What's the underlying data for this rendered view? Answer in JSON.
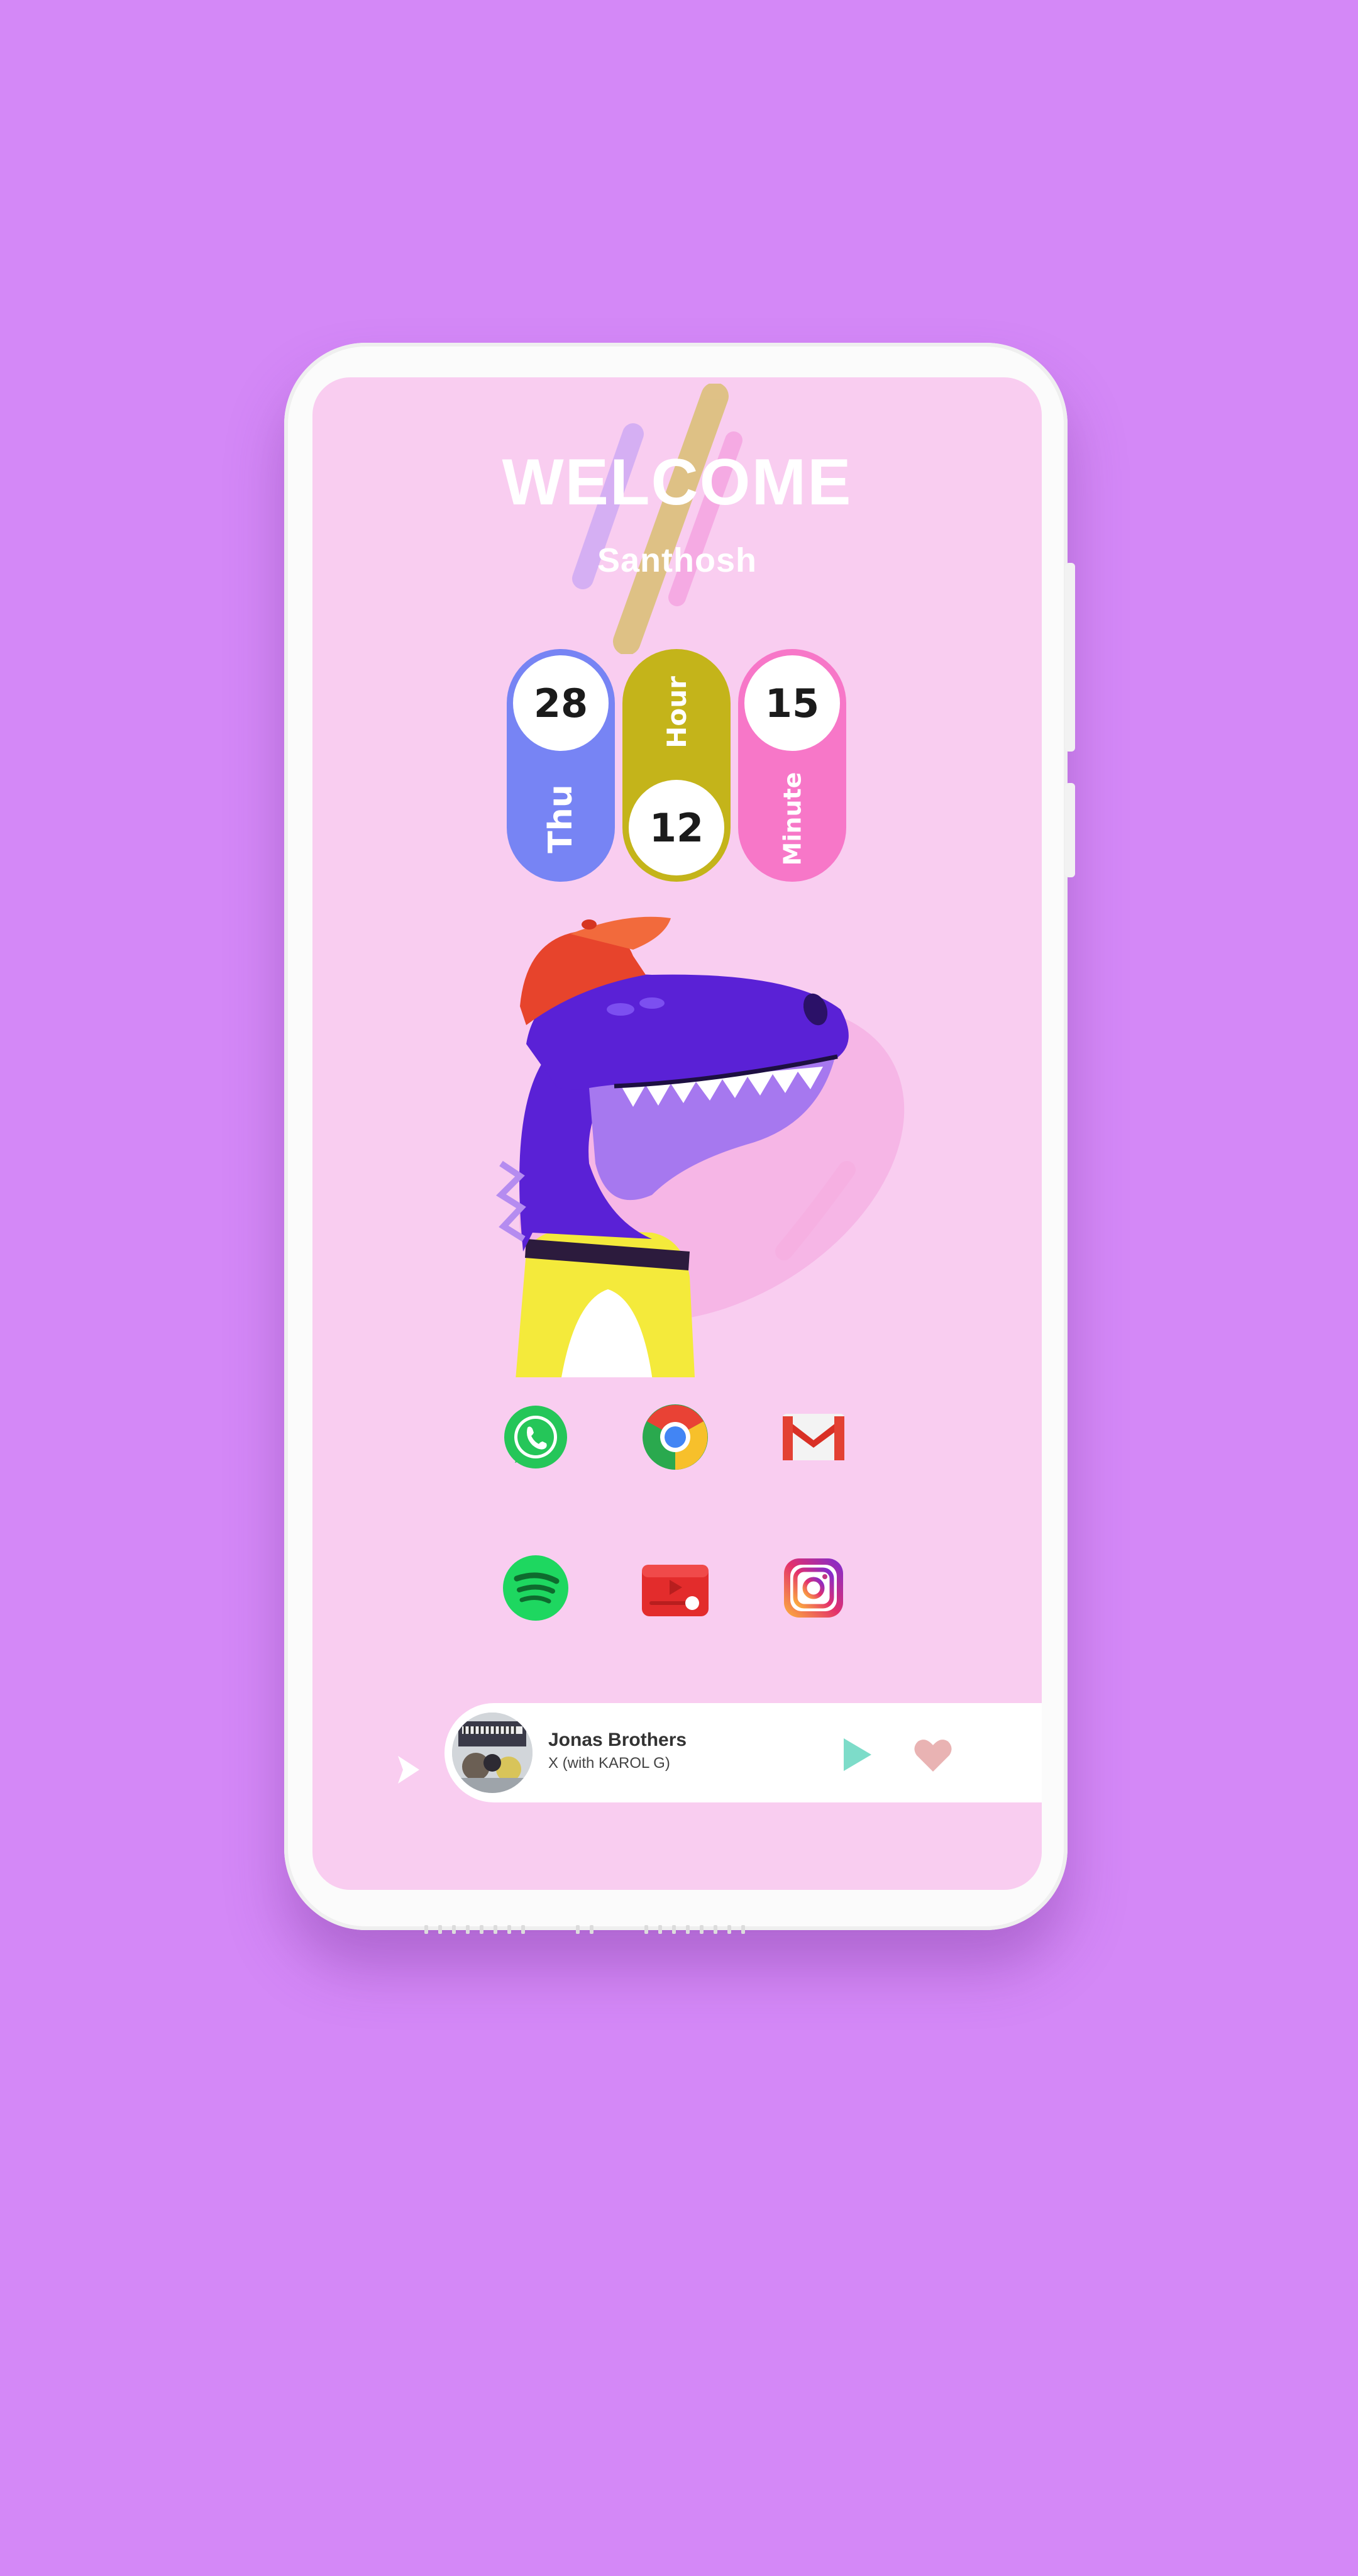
{
  "greeting": {
    "title": "WELCOME",
    "user_name": "Santhosh"
  },
  "clock_widget": {
    "date": "28",
    "day": "Thu",
    "hour_label": "Hour",
    "hour": "12",
    "minute": "15",
    "minute_label": "Minute",
    "colors": {
      "date_pill": "#7784f4",
      "hour_pill": "#c4b41a",
      "minute_pill": "#f777c8"
    }
  },
  "apps": [
    {
      "name": "whatsapp",
      "icon": "whatsapp-icon"
    },
    {
      "name": "chrome",
      "icon": "chrome-icon"
    },
    {
      "name": "gmail",
      "icon": "gmail-icon"
    },
    {
      "name": "spotify",
      "icon": "spotify-icon"
    },
    {
      "name": "youtube",
      "icon": "youtube-icon"
    },
    {
      "name": "instagram",
      "icon": "instagram-icon"
    }
  ],
  "music_player": {
    "artist": "Jonas Brothers",
    "track": "X (with KAROL G)",
    "play_icon": "play-icon",
    "like_icon": "heart-icon",
    "expand_icon": "chevron-right-icon"
  },
  "theme": {
    "background": "#d488f7",
    "screen": "#f9cdf0"
  }
}
